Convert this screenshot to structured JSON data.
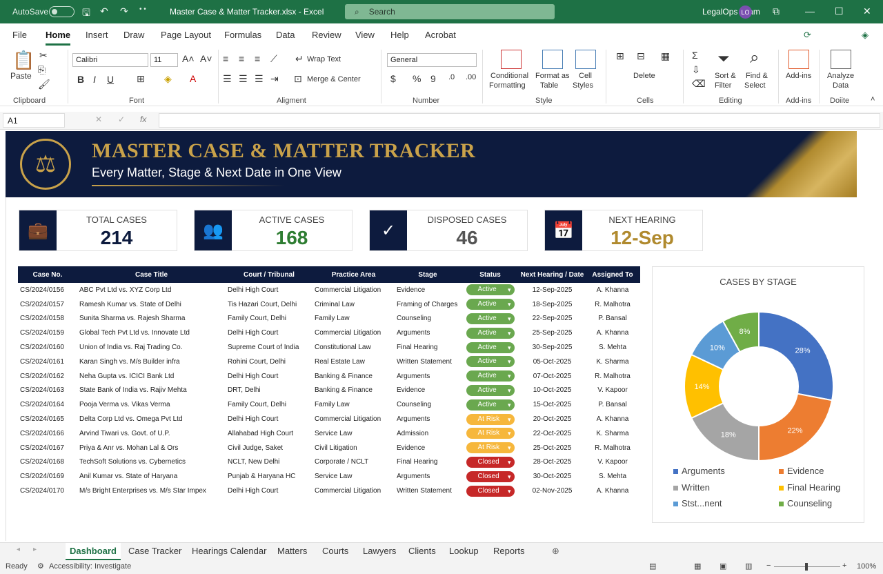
{
  "titlebar": {
    "autosave": "AutoSave",
    "title": "Master Case & Matter Tracker.xlsx  -  Excel",
    "search_placeholder": "Search",
    "user": "LegalOps Team",
    "avatar_initials": "LO"
  },
  "menu": [
    "File",
    "Home",
    "Insert",
    "Draw",
    "Page Layout",
    "Formulas",
    "Data",
    "Review",
    "View",
    "Help",
    "Acrobat"
  ],
  "ribbon": {
    "paste": "Paste",
    "clipboard": "Clipboard",
    "font_name": "Calibri",
    "font_size": "11",
    "font": "Font",
    "wrap": "Wrap Text",
    "merge": "Merge & Center",
    "alignment": "Aligment",
    "numfmt": "General",
    "number": "Number",
    "cond1": "Conditional",
    "cond2": "Formatting",
    "fmt1": "Format as",
    "fmt2": "Table",
    "cs1": "Cell",
    "cs2": "Styles",
    "styles": "Style",
    "delete": "Delete",
    "cells": "Cells",
    "sort1": "Sort &",
    "sort2": "Filter",
    "find1": "Find &",
    "find2": "Select",
    "editing": "Editing",
    "addins": "Add-ins",
    "addins_group": "Add-ins",
    "analyze1": "Analyze",
    "analyze2": "Data",
    "analyze_group": "Doiite"
  },
  "formula": {
    "namebox": "A1",
    "fx": "fx"
  },
  "banner": {
    "title": "MASTER CASE & MATTER TRACKER",
    "subtitle": "Every Matter, Stage & Next Date in One View"
  },
  "kpis": [
    {
      "label": "TOTAL CASES",
      "value": "214",
      "color": "#0d1b3e",
      "icon": "briefcase-gavel-icon"
    },
    {
      "label": "ACTIVE CASES",
      "value": "168",
      "color": "#2e7d32",
      "icon": "people-icon"
    },
    {
      "label": "DISPOSED CASES",
      "value": "46",
      "color": "#555555",
      "icon": "check-circle-icon"
    },
    {
      "label": "NEXT HEARING",
      "value": "12-Sep",
      "color": "#b08a2e",
      "icon": "calendar-icon"
    }
  ],
  "table": {
    "headers": [
      "Case No.",
      "Case Title",
      "Court / Tribunal",
      "Practice Area",
      "Stage",
      "Status",
      "Next Hearing / Date",
      "Assigned To"
    ],
    "rows": [
      [
        "CS/2024/0156",
        "ABC Pvt Ltd vs. XYZ Corp Ltd",
        "Delhi High Court",
        "Commercial Litigation",
        "Evidence",
        "Active",
        "12-Sep-2025",
        "A. Khanna"
      ],
      [
        "CS/2024/0157",
        "Ramesh Kumar vs. State of Delhi",
        "Tis Hazari Court, Delhi",
        "Criminal Law",
        "Framing of Charges",
        "Active",
        "18-Sep-2025",
        "R. Malhotra"
      ],
      [
        "CS/2024/0158",
        "Sunita Sharma vs. Rajesh Sharma",
        "Family Court, Delhi",
        "Family Law",
        "Counseling",
        "Active",
        "22-Sep-2025",
        "P. Bansal"
      ],
      [
        "CS/2024/0159",
        "Global Tech Pvt Ltd vs. Innovate Ltd",
        "Delhi High Court",
        "Commercial Litigation",
        "Arguments",
        "Active",
        "25-Sep-2025",
        "A. Khanna"
      ],
      [
        "CS/2024/0160",
        "Union of India vs. Raj Trading Co.",
        "Supreme Court of India",
        "Constitutional Law",
        "Final Hearing",
        "Active",
        "30-Sep-2025",
        "S. Mehta"
      ],
      [
        "CS/2024/0161",
        "Karan Singh vs. M/s Builder infra",
        "Rohini Court, Delhi",
        "Real Estate Law",
        "Written Statement",
        "Active",
        "05-Oct-2025",
        "K. Sharma"
      ],
      [
        "CS/2024/0162",
        "Neha Gupta vs. ICICI Bank Ltd",
        "Delhi High Court",
        "Banking & Finance",
        "Arguments",
        "Active",
        "07-Oct-2025",
        "R. Malhotra"
      ],
      [
        "CS/2024/0163",
        "State Bank of India vs. Rajiv Mehta",
        "DRT, Delhi",
        "Banking & Finance",
        "Evidence",
        "Active",
        "10-Oct-2025",
        "V. Kapoor"
      ],
      [
        "CS/2024/0164",
        "Pooja Verma vs. Vikas Verma",
        "Family Court, Delhi",
        "Family Law",
        "Counseling",
        "Active",
        "15-Oct-2025",
        "P. Bansal"
      ],
      [
        "CS/2024/0165",
        "Delta Corp Ltd vs. Omega Pvt Ltd",
        "Delhi High Court",
        "Commercial Litigation",
        "Arguments",
        "At Risk",
        "20-Oct-2025",
        "A. Khanna"
      ],
      [
        "CS/2024/0166",
        "Arvind Tiwari vs. Govt. of U.P.",
        "Allahabad High Court",
        "Service Law",
        "Admission",
        "At Risk",
        "22-Oct-2025",
        "K. Sharma"
      ],
      [
        "CS/2024/0167",
        "Priya & Anr vs. Mohan Lal & Ors",
        "Civil Judge, Saket",
        "Civil Litigation",
        "Evidence",
        "At Risk",
        "25-Oct-2025",
        "R. Malhotra"
      ],
      [
        "CS/2024/0168",
        "TechSoft Solutions vs. Cybernetics",
        "NCLT, New Delhi",
        "Corporate / NCLT",
        "Final Hearing",
        "Closed",
        "28-Oct-2025",
        "V. Kapoor"
      ],
      [
        "CS/2024/0169",
        "Anil Kumar vs. State of Haryana",
        "Punjab & Haryana HC",
        "Service Law",
        "Arguments",
        "Closed",
        "30-Oct-2025",
        "S. Mehta"
      ],
      [
        "CS/2024/0170",
        "M/s Bright Enterprises vs. M/s Star Impex",
        "Delhi High Court",
        "Commercial Litigation",
        "Written Statement",
        "Closed",
        "02-Nov-2025",
        "A. Khanna"
      ]
    ],
    "status_colors": {
      "Active": "#6aa84f",
      "At Risk": "#f6b73c",
      "Closed": "#c62828"
    }
  },
  "chart_data": {
    "type": "pie",
    "title": "CASES BY STAGE",
    "slices": [
      {
        "label": "Arguments",
        "value": 28,
        "color": "#4472c4"
      },
      {
        "label": "Evidence",
        "value": 22,
        "color": "#ed7d31"
      },
      {
        "label": "Written",
        "value": 18,
        "color": "#a5a5a5"
      },
      {
        "label": "Final Hearing",
        "value": 14,
        "color": "#ffc000"
      },
      {
        "label": "Stst...nent",
        "value": 10,
        "color": "#5b9bd5"
      },
      {
        "label": "Counseling",
        "value": 8,
        "color": "#70ad47"
      }
    ],
    "slice_labels": [
      "28%",
      "22%",
      "18%",
      "14%",
      "10%",
      "8%"
    ],
    "legend_placement": "bottom",
    "legend": [
      "Arguments",
      "Evidence",
      "Written",
      "Final Hearing",
      "Stst́nenent",
      "Counseling"
    ]
  },
  "tabs": [
    "Dashboard",
    "Case Tracker",
    "Hearings Calendar",
    "Matters",
    "Courts",
    "Lawyers",
    "Clients",
    "Lookup",
    "Reports"
  ],
  "status": {
    "ready": "Ready",
    "accessibility": "Accessibility: Investigate",
    "zoom": "100%"
  }
}
